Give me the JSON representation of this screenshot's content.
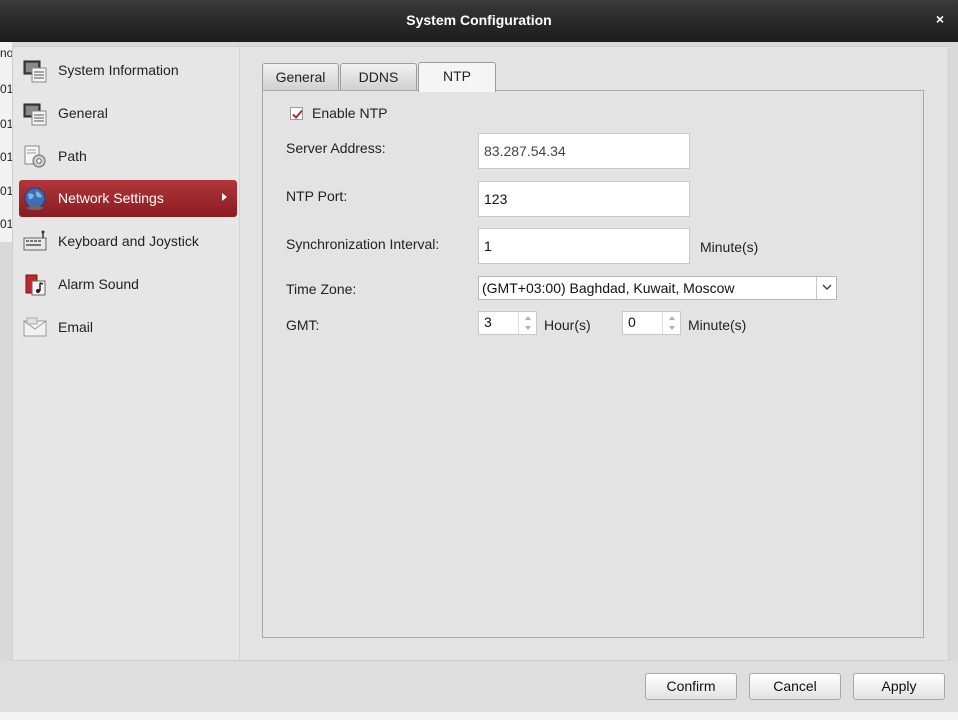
{
  "window": {
    "title": "System Configuration",
    "close_glyph": "×"
  },
  "background_edge": [
    "no",
    "01",
    "01",
    "01",
    "01",
    "01"
  ],
  "sidebar": {
    "items": [
      {
        "label": "System Information",
        "icon": "monitor-list-icon"
      },
      {
        "label": "General",
        "icon": "monitor-list-icon"
      },
      {
        "label": "Path",
        "icon": "gear-doc-icon"
      },
      {
        "label": "Network Settings",
        "icon": "globe-icon",
        "active": true
      },
      {
        "label": "Keyboard and Joystick",
        "icon": "keyboard-icon"
      },
      {
        "label": "Alarm Sound",
        "icon": "alarm-music-icon"
      },
      {
        "label": "Email",
        "icon": "envelope-icon"
      }
    ]
  },
  "tabs": [
    {
      "label": "General"
    },
    {
      "label": "DDNS"
    },
    {
      "label": "NTP",
      "selected": true
    }
  ],
  "ntp": {
    "enable_label": "Enable NTP",
    "enabled": true,
    "server_address_label": "Server Address:",
    "server_address_value": "83.287.54.34",
    "ntp_port_label": "NTP Port:",
    "ntp_port_value": "123",
    "sync_interval_label": "Synchronization Interval:",
    "sync_interval_value": "1",
    "sync_interval_unit": "Minute(s)",
    "time_zone_label": "Time Zone:",
    "time_zone_value": "(GMT+03:00) Baghdad, Kuwait, Moscow",
    "gmt_label": "GMT:",
    "gmt_hours_value": "3",
    "gmt_hours_unit": "Hour(s)",
    "gmt_minutes_value": "0",
    "gmt_minutes_unit": "Minute(s)"
  },
  "footer": {
    "confirm": "Confirm",
    "cancel": "Cancel",
    "apply": "Apply"
  },
  "colors": {
    "accent": "#9b2226",
    "titlebar": "#262626"
  }
}
